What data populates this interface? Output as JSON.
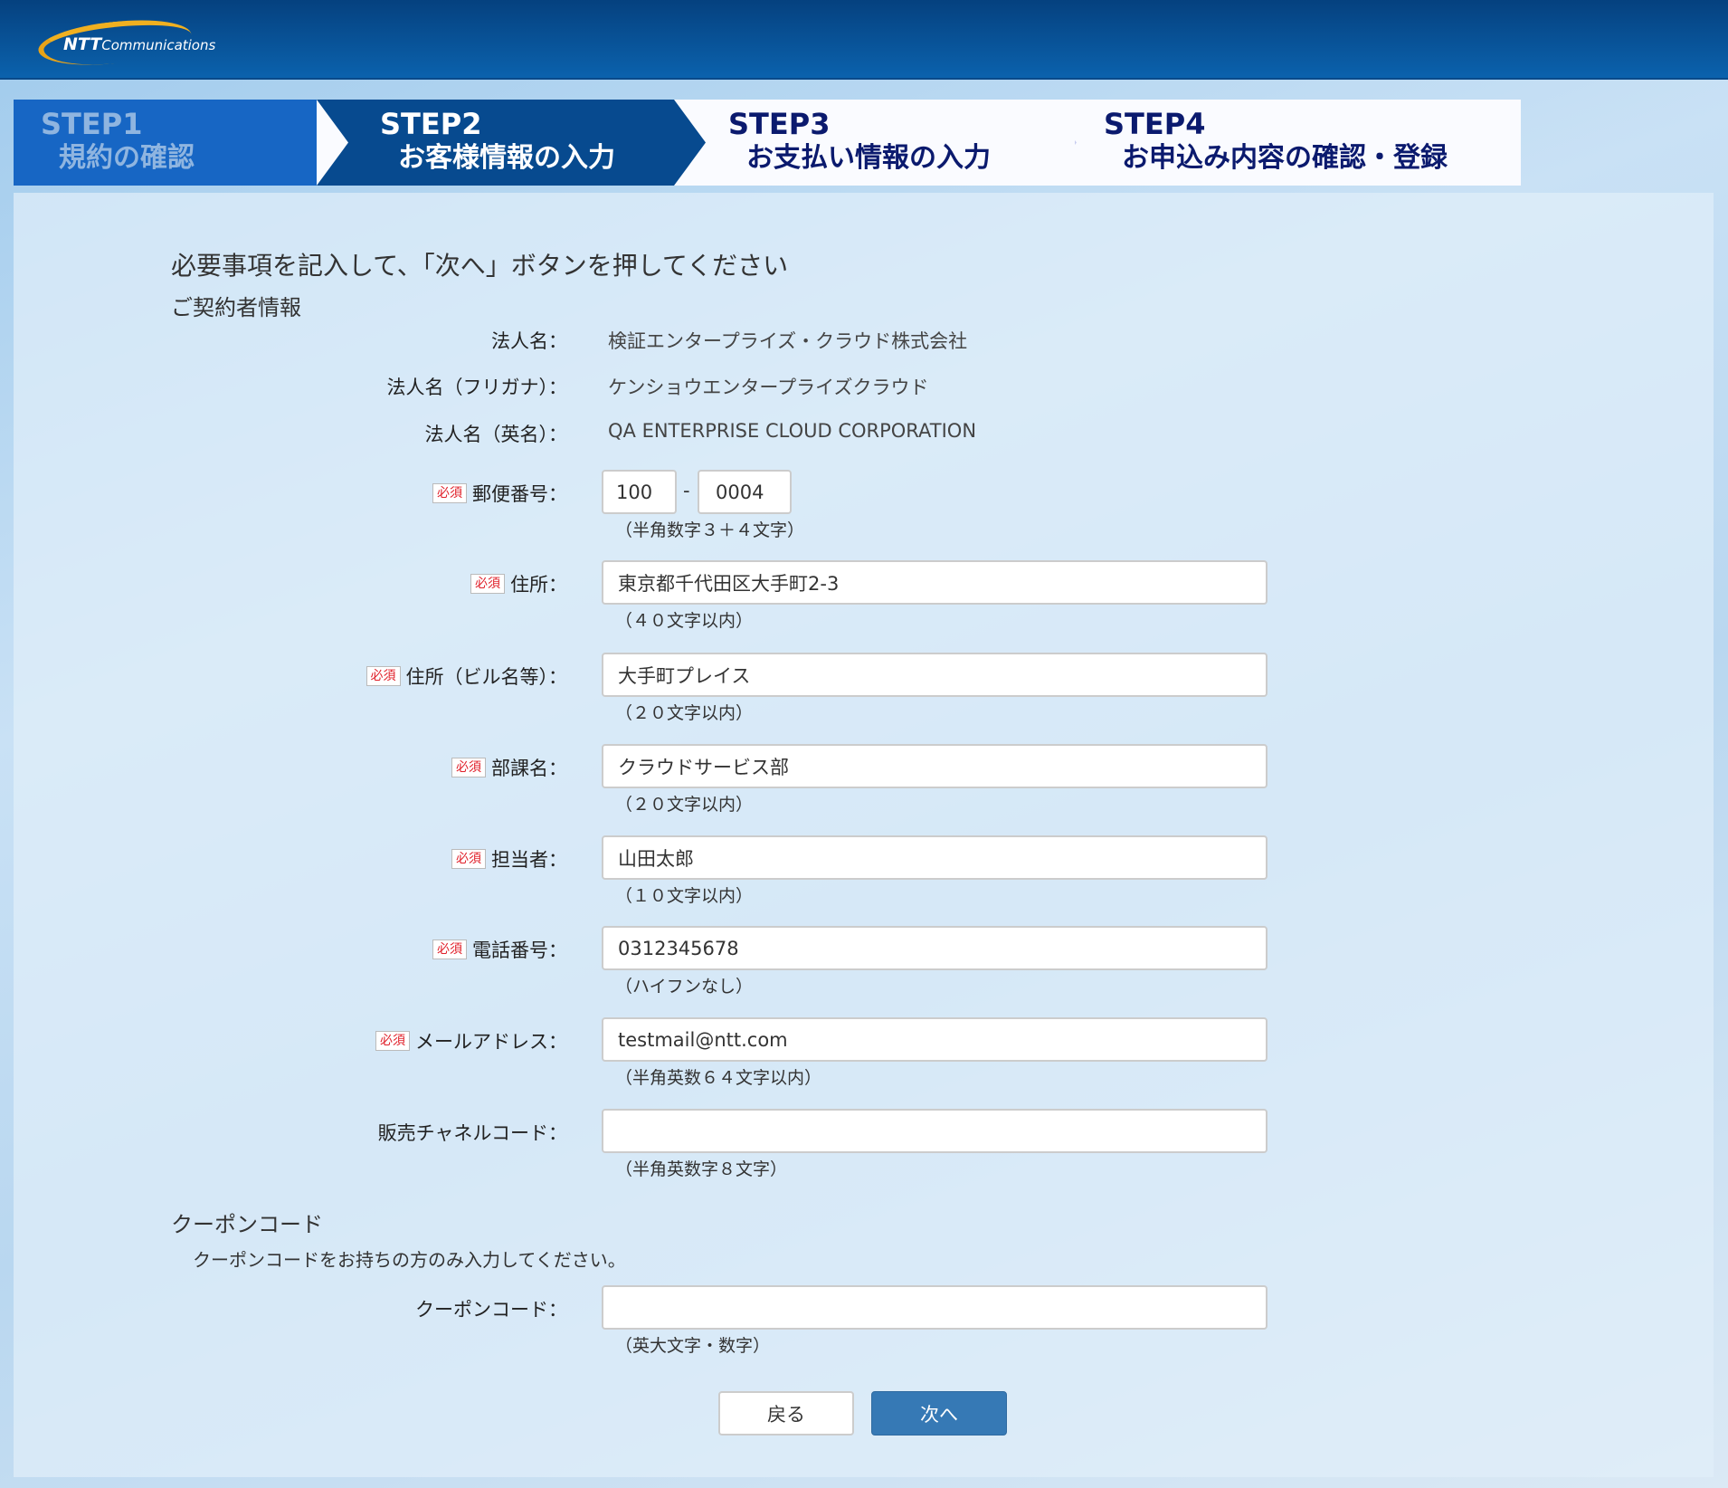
{
  "header": {
    "logo_text_bold": "NTT",
    "logo_text": "Communications"
  },
  "steps": [
    {
      "number": "STEP1",
      "label": "規約の確認"
    },
    {
      "number": "STEP2",
      "label": "お客様情報の入力"
    },
    {
      "number": "STEP3",
      "label": "お支払い情報の入力"
    },
    {
      "number": "STEP4",
      "label": "お申込み内容の確認・登録"
    }
  ],
  "instruction": "必要事項を記入して、「次へ」ボタンを押してください",
  "contractor_heading": "ご契約者情報",
  "required_badge": "必須",
  "company": {
    "label": "法人名：",
    "value": "検証エンタープライズ・クラウド株式会社"
  },
  "company_kana": {
    "label": "法人名（フリガナ）：",
    "value": "ケンショウエンタープライズクラウド"
  },
  "company_en": {
    "label": "法人名（英名）：",
    "value": "QA ENTERPRISE CLOUD CORPORATION"
  },
  "postal": {
    "label": "郵便番号：",
    "value1": "100",
    "separator": "-",
    "value2": "0004",
    "hint": "（半角数字３＋４文字）"
  },
  "address": {
    "label": "住所：",
    "value": "東京都千代田区大手町2-3",
    "hint": "（４０文字以内）"
  },
  "building": {
    "label": "住所（ビル名等）：",
    "value": "大手町プレイス",
    "hint": "（２０文字以内）"
  },
  "department": {
    "label": "部課名：",
    "value": "クラウドサービス部",
    "hint": "（２０文字以内）"
  },
  "person": {
    "label": "担当者：",
    "value": "山田太郎",
    "hint": "（１０文字以内）"
  },
  "phone": {
    "label": "電話番号：",
    "value": "0312345678",
    "hint": "（ハイフンなし）"
  },
  "email": {
    "label": "メールアドレス：",
    "value": "testmail@ntt.com",
    "hint": "（半角英数６４文字以内）"
  },
  "channel": {
    "label": "販売チャネルコード：",
    "value": "",
    "hint": "（半角英数字８文字）"
  },
  "coupon": {
    "heading": "クーポンコード",
    "description": "クーポンコードをお持ちの方のみ入力してください。",
    "label": "クーポンコード：",
    "value": "",
    "hint": "（英大文字・数字）"
  },
  "buttons": {
    "back": "戻る",
    "next": "次へ"
  }
}
